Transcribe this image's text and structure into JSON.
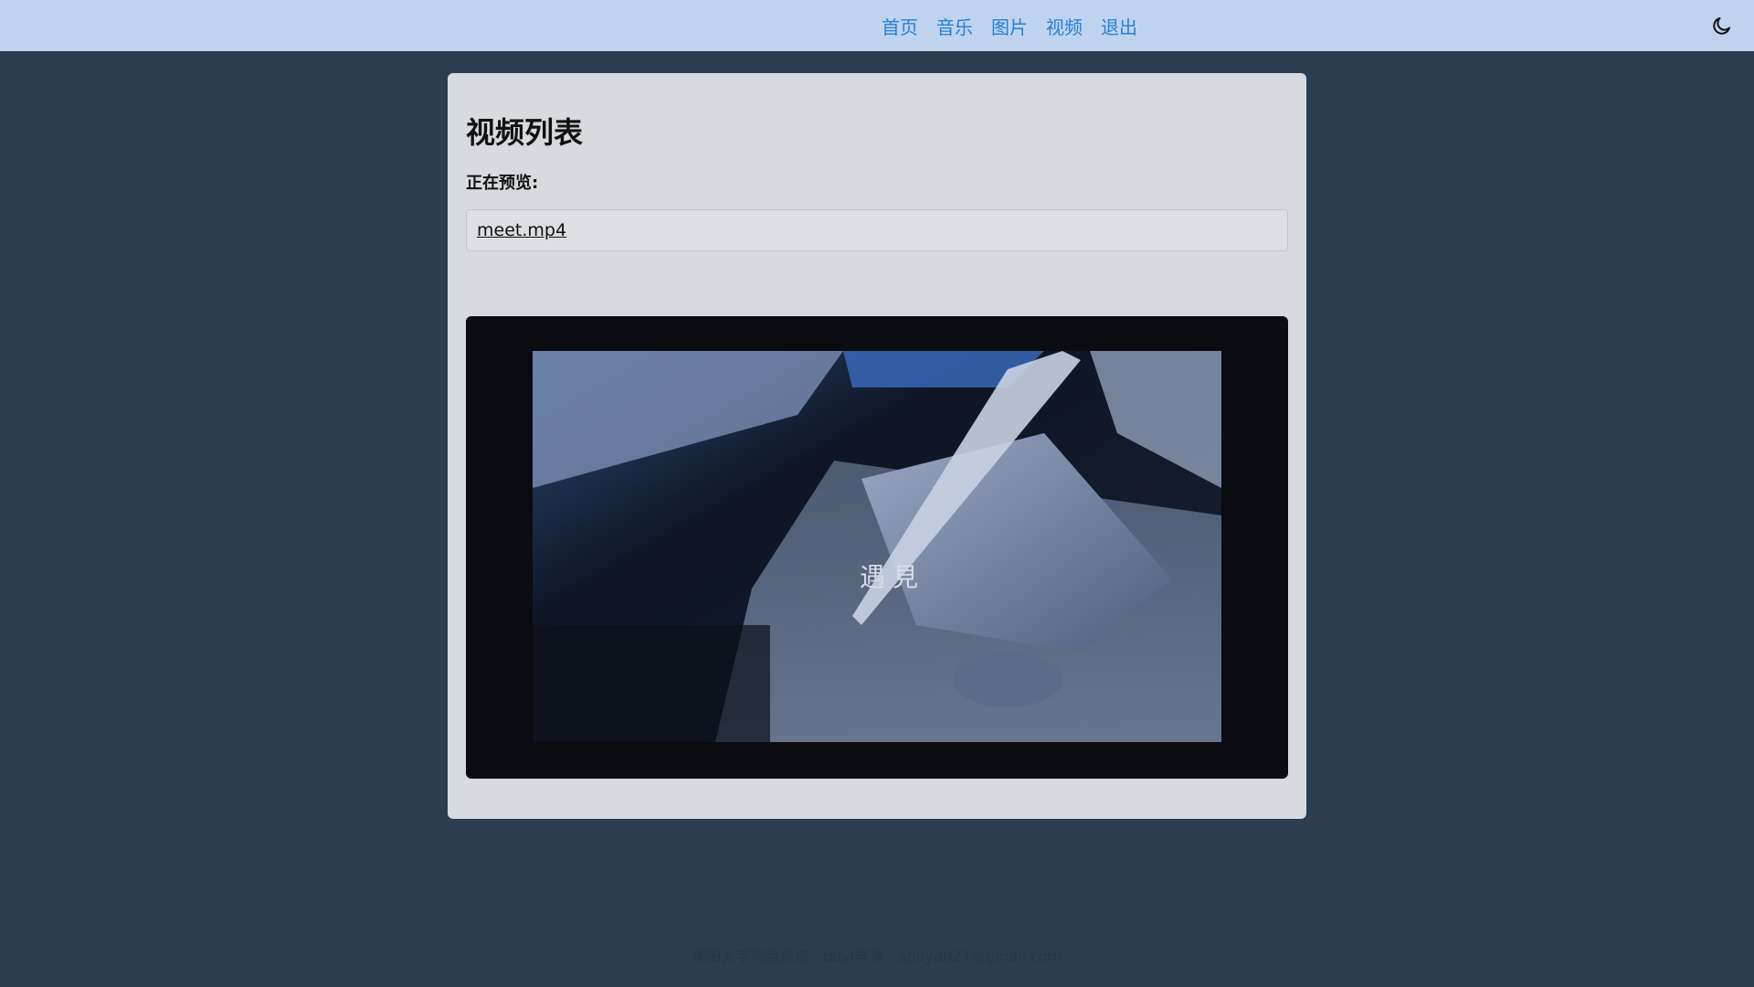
{
  "nav": {
    "links": [
      {
        "label": "首页"
      },
      {
        "label": "音乐"
      },
      {
        "label": "图片"
      },
      {
        "label": "视频"
      },
      {
        "label": "退出"
      }
    ],
    "theme_icon": "moon-icon"
  },
  "main": {
    "title": "视频列表",
    "preview_label": "正在预览:",
    "file_name": "meet.mp4",
    "video": {
      "caption": "遇見",
      "background_color": "#0a0c11"
    }
  },
  "footer": {
    "text": "揭阳大学网盘系统 · buyi导演 · apuyu027@gmail.com"
  },
  "colors": {
    "page_background": "#2d3d50",
    "nav_background": "#bfd3ee",
    "nav_link": "#2680d6",
    "card_background": "#d7dadf"
  }
}
